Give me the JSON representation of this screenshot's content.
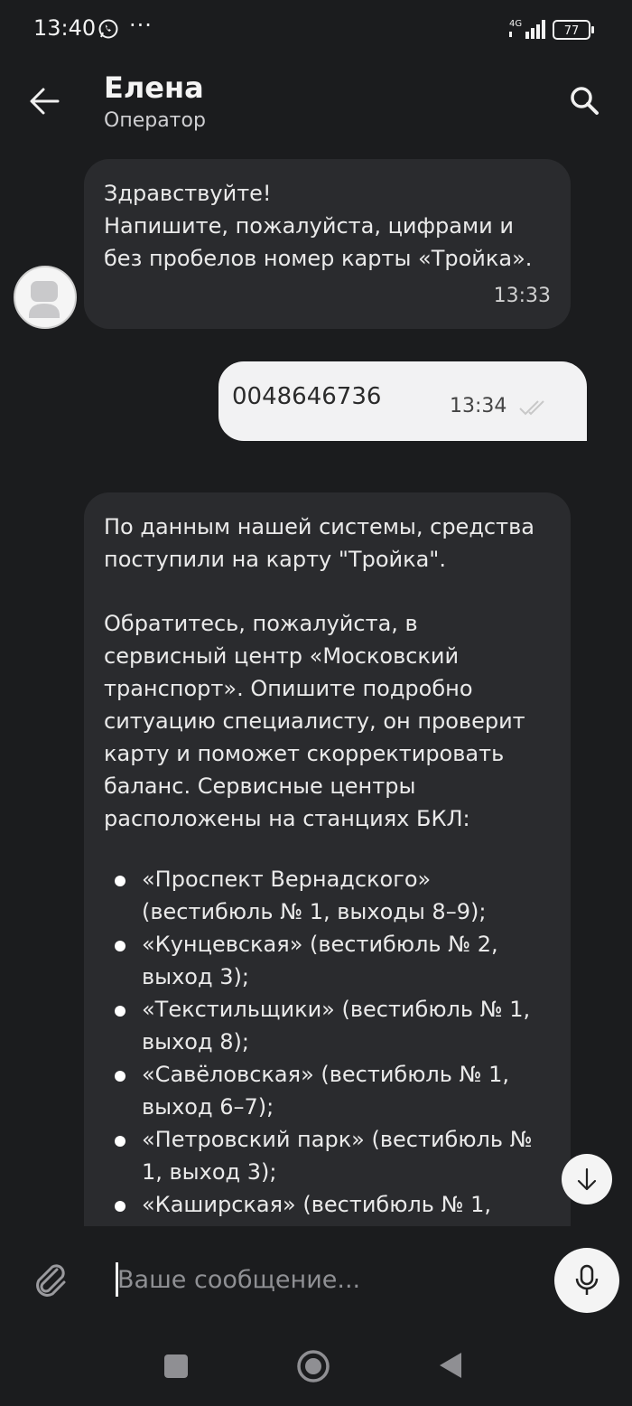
{
  "status_bar": {
    "time": "13:40",
    "network": "4G",
    "battery": "77"
  },
  "header": {
    "title": "Елена",
    "subtitle": "Оператор"
  },
  "messages": [
    {
      "side": "in",
      "text": "Здравствуйте!\nНапишите, пожалуйста, цифрами и\nбез пробелов номер карты «Тройка».",
      "time": "13:33"
    },
    {
      "side": "out",
      "text": "0048646736",
      "time": "13:34"
    },
    {
      "side": "in",
      "paragraph1": "По данным нашей системы, средства\nпоступили на карту \"Тройка\".",
      "paragraph2": "Обратитесь, пожалуйста, в\nсервисный центр «Московский\nтранспорт». Опишите подробно\nситуацию специалисту, он проверит\nкарту и поможет скорректировать\nбаланс. Сервисные центры\nрасположены на станциях БКЛ:",
      "list": [
        "«Проспект Вернадского» (вестибюль № 1, выходы 8–9);",
        "«Кунцевская» (вестибюль № 2, выход 3);",
        "«Текстильщики» (вестибюль № 1, выход 8);",
        "«Савёловская» (вестибюль № 1, выход 6–7);",
        "«Петровский парк» (вестибюль № 1, выход 3);",
        "«Каширская» (вестибюль № 1,"
      ]
    }
  ],
  "composer": {
    "placeholder": "Ваше сообщение..."
  }
}
